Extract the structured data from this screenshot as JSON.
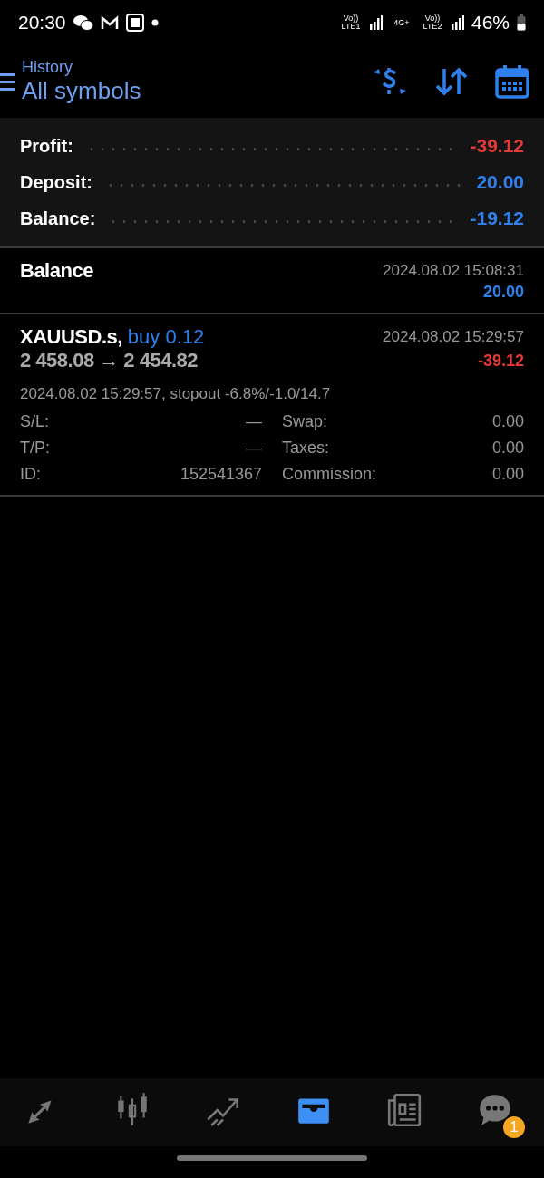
{
  "status_bar": {
    "time": "20:30",
    "network": [
      "Vo)) LTE1",
      "4G+",
      "Vo)) LTE2"
    ],
    "battery": "46%"
  },
  "header": {
    "subtitle": "History",
    "title": "All symbols"
  },
  "summary": [
    {
      "label": "Profit:",
      "value": "-39.12",
      "color": "#e53935"
    },
    {
      "label": "Deposit:",
      "value": "20.00",
      "color": "#2f80ed"
    },
    {
      "label": "Balance:",
      "value": "-19.12",
      "color": "#2f80ed"
    }
  ],
  "entries": [
    {
      "kind": "balance",
      "title": "Balance",
      "time": "2024.08.02 15:08:31",
      "amount": "20.00",
      "color": "#2f80ed"
    },
    {
      "kind": "deal",
      "symbol": "XAUUSD.s,",
      "side": "buy 0.12",
      "prices": "2 458.08 → 2 454.82",
      "time": "2024.08.02 15:29:57",
      "amount": "-39.12",
      "color": "#e53935",
      "comment": "2024.08.02 15:29:57, stopout -6.8%/-1.0/14.7",
      "details": [
        {
          "label": "S/L:",
          "value": "—",
          "label2": "Swap:",
          "value2": "0.00"
        },
        {
          "label": "T/P:",
          "value": "—",
          "label2": "Taxes:",
          "value2": "0.00"
        },
        {
          "label": "ID:",
          "value": "152541367",
          "label2": "Commission:",
          "value2": "0.00"
        }
      ]
    }
  ],
  "nav": [
    {
      "kind": "trade",
      "selected": false
    },
    {
      "kind": "chart",
      "selected": false
    },
    {
      "kind": "trend",
      "selected": false
    },
    {
      "kind": "history",
      "selected": true
    },
    {
      "kind": "news",
      "selected": false
    },
    {
      "kind": "chat",
      "selected": false,
      "badge": "1"
    }
  ]
}
